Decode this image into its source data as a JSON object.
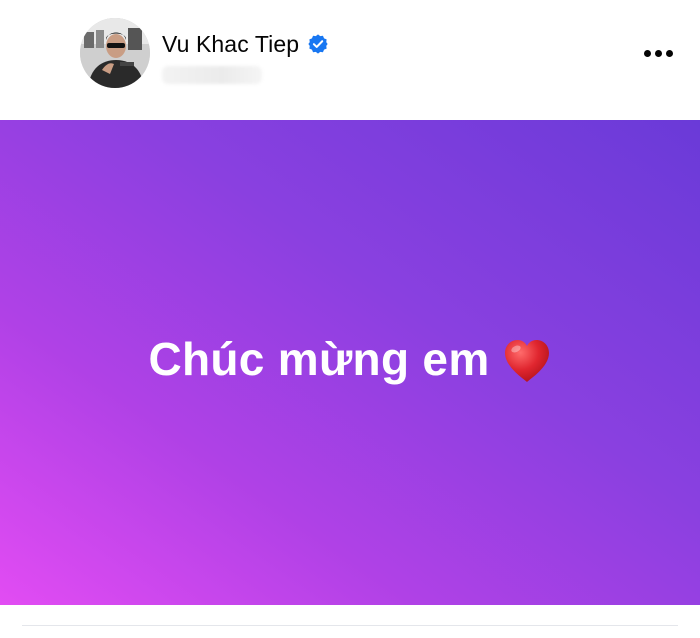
{
  "post": {
    "author": {
      "name": "Vu Khac Tiep",
      "verified": true,
      "avatar_icon": "profile-photo"
    },
    "menu_icon": "more-horizontal-icon",
    "status": {
      "text": "Chúc mừng em",
      "emoji_icon": "red-heart-icon",
      "background_gradient": [
        "#e24cf3",
        "#b041e6",
        "#8a40e0",
        "#6a3ad8"
      ],
      "text_color": "#ffffff"
    },
    "colors": {
      "verified_badge": "#1877f2",
      "heart": "#e0262f"
    }
  }
}
